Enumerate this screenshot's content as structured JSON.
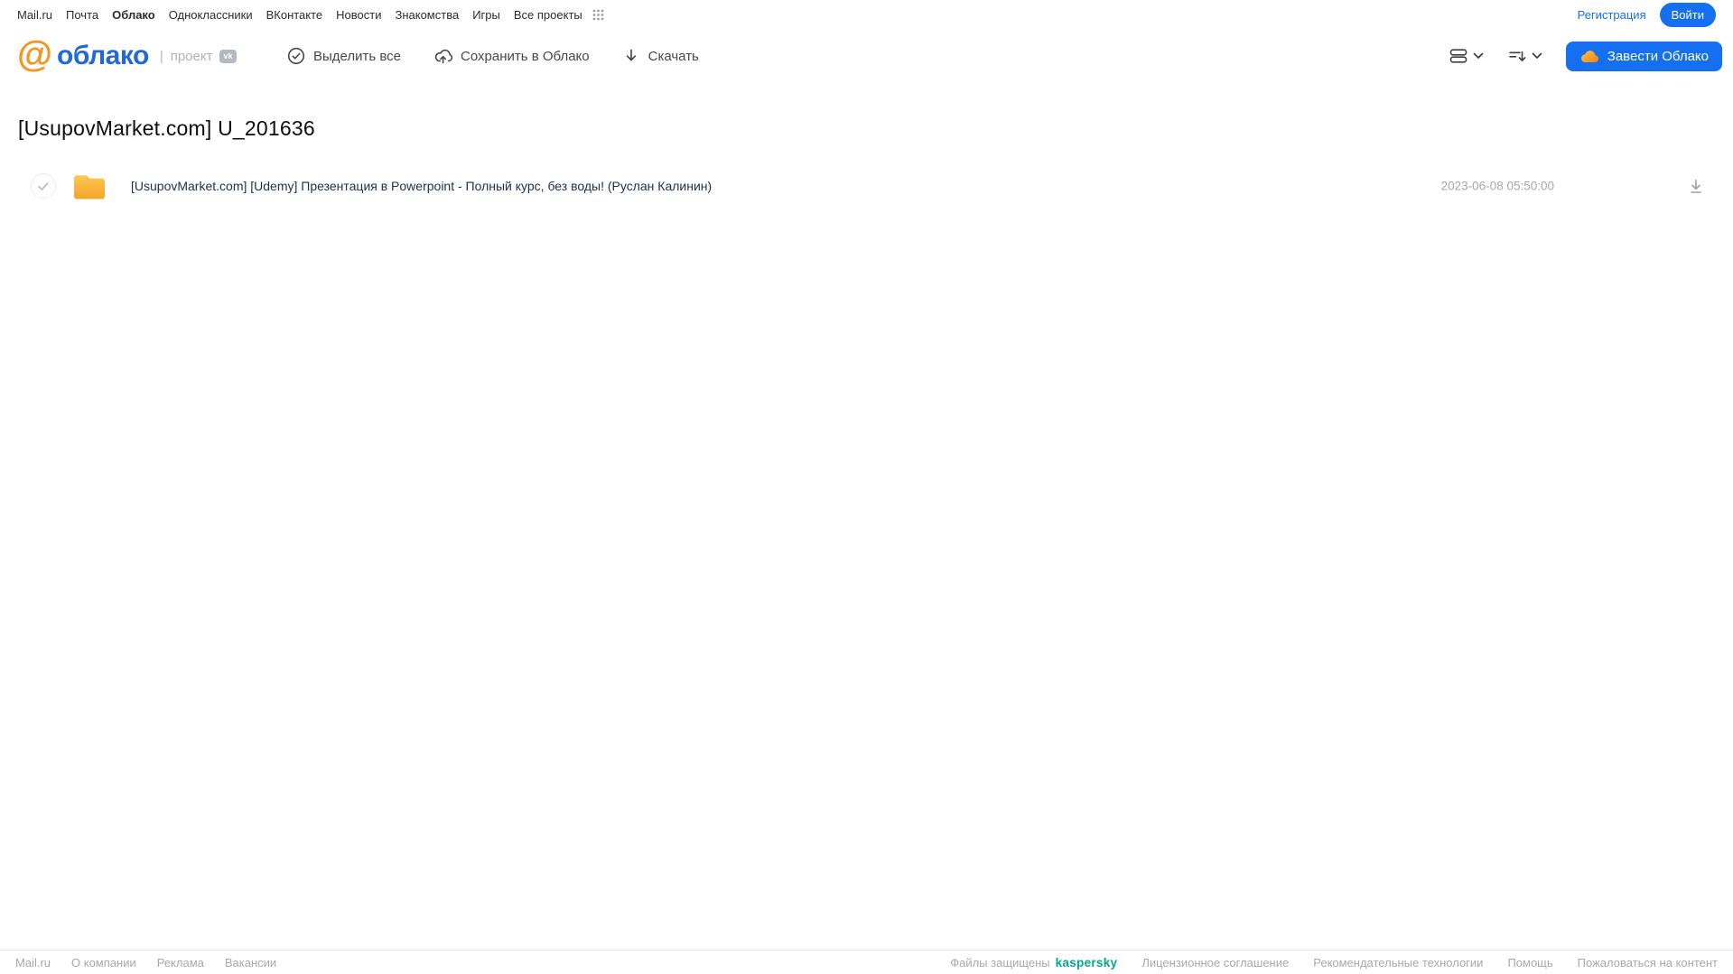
{
  "topnav": {
    "items": [
      "Mail.ru",
      "Почта",
      "Облако",
      "Одноклассники",
      "ВКонтакте",
      "Новости",
      "Знакомства",
      "Игры",
      "Все проекты"
    ],
    "active_item": "Облако",
    "register_label": "Регистрация",
    "login_label": "Войти"
  },
  "header": {
    "logo_at": "@",
    "logo_text": "облако",
    "logo_project": "проект",
    "vk_badge": "vk",
    "select_all_label": "Выделить все",
    "save_to_cloud_label": "Сохранить в Облако",
    "download_label": "Скачать",
    "get_cloud_label": "Завести Облако"
  },
  "main": {
    "title": "[UsupovMarket.com] U_201636"
  },
  "file_list": [
    {
      "name": "[UsupovMarket.com] [Udemy] Презентация в Powerpoint - Полный курс, без воды! (Руслан Калинин)",
      "date": "2023-06-08 05:50:00",
      "type": "folder"
    }
  ],
  "footer": {
    "left_links": [
      "Mail.ru",
      "О компании",
      "Реклама",
      "Вакансии"
    ],
    "protected_label": "Файлы защищены",
    "kaspersky_label": "kaspersky",
    "right_links": [
      "Лицензионное соглашение",
      "Рекомендательные технологии",
      "Помощь",
      "Пожаловаться на контент"
    ]
  },
  "colors": {
    "accent_blue": "#1470f0",
    "logo_blue": "#2368d6",
    "logo_orange": "#f7941d",
    "folder_yellow_top": "#fdc851",
    "folder_yellow_bottom": "#f3a62a",
    "kaspersky_green": "#00a88e",
    "muted_text": "#a5a9ad",
    "dark_text": "#2c2d2e"
  }
}
